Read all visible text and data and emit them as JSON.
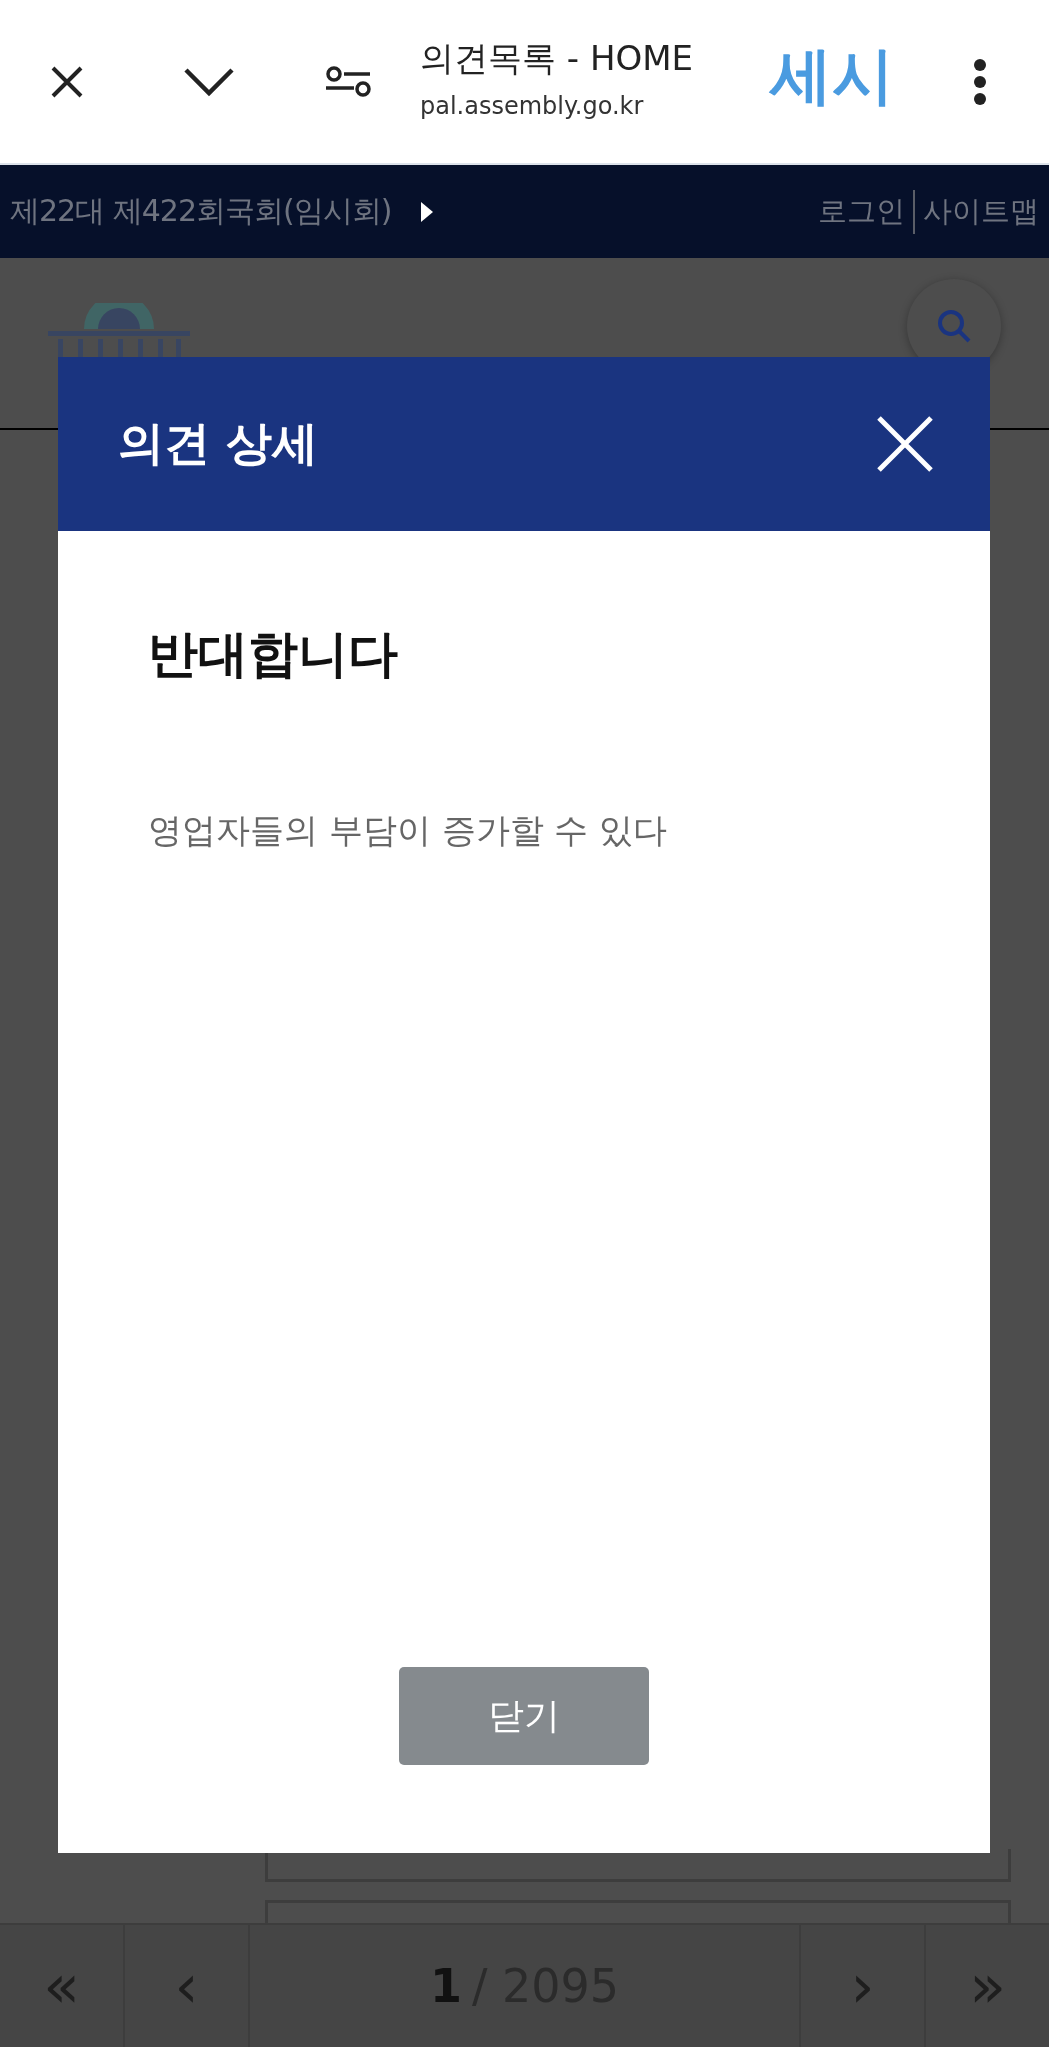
{
  "browser": {
    "title": "의견목록 - HOME",
    "url": "pal.assembly.go.kr",
    "badge": "세시"
  },
  "top_bar": {
    "session": "제22대 제422회국회(임시회)",
    "links": [
      "로그인",
      "사이트맵"
    ]
  },
  "modal": {
    "title": "의견 상세",
    "heading": "반대합니다",
    "body": "영업자들의 부담이 증가할 수 있다",
    "button": "닫기"
  },
  "pagination": {
    "current": "1",
    "total": "/ 2095",
    "first": "«",
    "prev": "‹",
    "next": "›",
    "last": "»"
  }
}
